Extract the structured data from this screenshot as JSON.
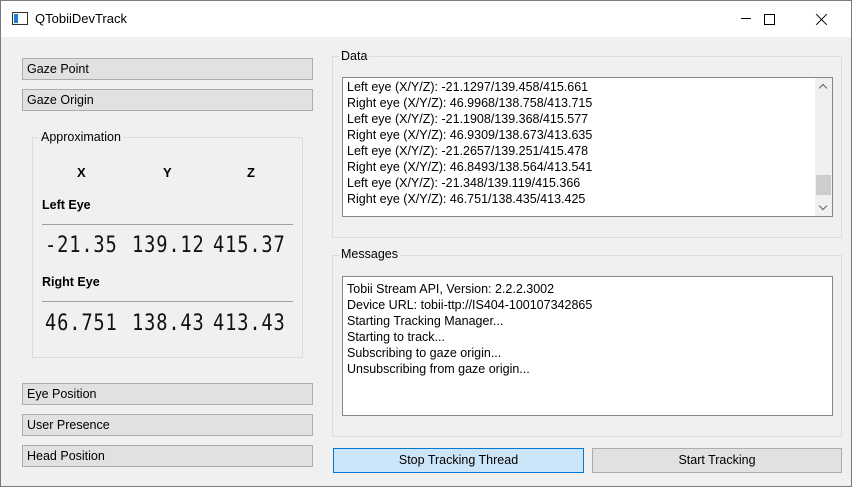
{
  "window": {
    "title": "QTobiiDevTrack"
  },
  "left_buttons": {
    "gaze_point": "Gaze Point",
    "gaze_origin": "Gaze Origin",
    "eye_position": "Eye Position",
    "user_presence": "User Presence",
    "head_position": "Head Position"
  },
  "approximation": {
    "title": "Approximation",
    "axes": [
      "X",
      "Y",
      "Z"
    ],
    "left_eye": {
      "label": "Left Eye",
      "values": [
        "-21.35",
        "139.12",
        "415.37"
      ]
    },
    "right_eye": {
      "label": "Right Eye",
      "values": [
        "46.751",
        "138.43",
        "413.43"
      ]
    }
  },
  "data_panel": {
    "title": "Data",
    "lines": [
      "Left eye (X/Y/Z): -21.1297/139.458/415.661",
      "Right eye (X/Y/Z): 46.9968/138.758/413.715",
      "Left eye (X/Y/Z): -21.1908/139.368/415.577",
      "Right eye (X/Y/Z): 46.9309/138.673/413.635",
      "Left eye (X/Y/Z): -21.2657/139.251/415.478",
      "Right eye (X/Y/Z): 46.8493/138.564/413.541",
      "Left eye (X/Y/Z): -21.348/139.119/415.366",
      "Right eye (X/Y/Z): 46.751/138.435/413.425"
    ]
  },
  "messages_panel": {
    "title": "Messages",
    "lines": [
      "Tobii Stream API, Version: 2.2.2.3002",
      "Device URL: tobii-ttp://IS404-100107342865",
      "Starting Tracking Manager...",
      "Starting to track...",
      "Subscribing to gaze origin...",
      "Unsubscribing from gaze origin..."
    ]
  },
  "bottom_buttons": {
    "stop_tracking_thread": "Stop Tracking Thread",
    "start_tracking": "Start Tracking"
  },
  "colors": {
    "window_bg": "#f0f0f0",
    "button_bg": "#e1e1e1",
    "active_button_bg": "#cce4f7",
    "active_button_border": "#0078d7"
  },
  "icons": {
    "app": "app-window-icon",
    "minimize": "minimize-icon",
    "maximize": "maximize-icon",
    "close": "close-icon"
  }
}
